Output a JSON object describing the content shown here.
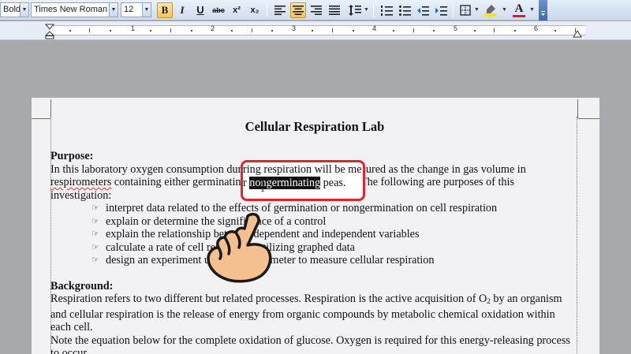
{
  "toolbar": {
    "style_value": "Bold,",
    "font_name": "Times New Roman",
    "font_size": "12",
    "bold_label": "B",
    "italic_label": "I",
    "underline_label": "U",
    "strike_label": "abc",
    "superscript_label": "x²",
    "subscript_label": "x₂",
    "font_color_label": "A",
    "highlight_color": "#f7e02a",
    "font_color": "#d42020"
  },
  "ruler": {
    "numbers": [
      "1",
      "2",
      "3",
      "4",
      "5",
      "6"
    ]
  },
  "document": {
    "title": "Cellular Respiration Lab",
    "purpose_heading": "Purpose:",
    "purpose_line1": "In this laboratory oxygen consumption during respiration will be measured as the change in gas volume in",
    "purpose_line2_a": "respirometers",
    "purpose_line2_b": " containing either germinating or ",
    "purpose_line2_selected": "nongerminating",
    "purpose_line2_c": " peas.  The following are purposes of this",
    "purpose_line3": "investigation:",
    "bullets": [
      "interpret data related to the effects of germination or nongermination on cell respiration",
      "explain or determine the significance of a control",
      "explain the relationship between dependent and independent variables",
      "calculate a rate of cell respiration utilizing graphed data",
      "design an experiment using a respirometer to measure cellular respiration"
    ],
    "background_heading": "Background:",
    "bg_line1_a": "Respiration refers to two different but related processes. Respiration is the active acquisition of O",
    "bg_line1_sub": "2",
    "bg_line1_b": " by an organism",
    "bg_line2": "and cellular respiration is the release of energy from organic compounds by metabolic chemical oxidation within",
    "bg_line3": "each cell.",
    "bg_line4": "Note the equation below for the complete oxidation of glucose. Oxygen is required for this energy-releasing process",
    "bg_line5": "to occur."
  },
  "callout": {
    "line1": "ring respiration will be me",
    "line2_pre": "r ",
    "line2_sel": "nongerminating",
    "line2_post": " peas.",
    "border_color": "#e3242b"
  },
  "hand_color": "#f5c08f"
}
